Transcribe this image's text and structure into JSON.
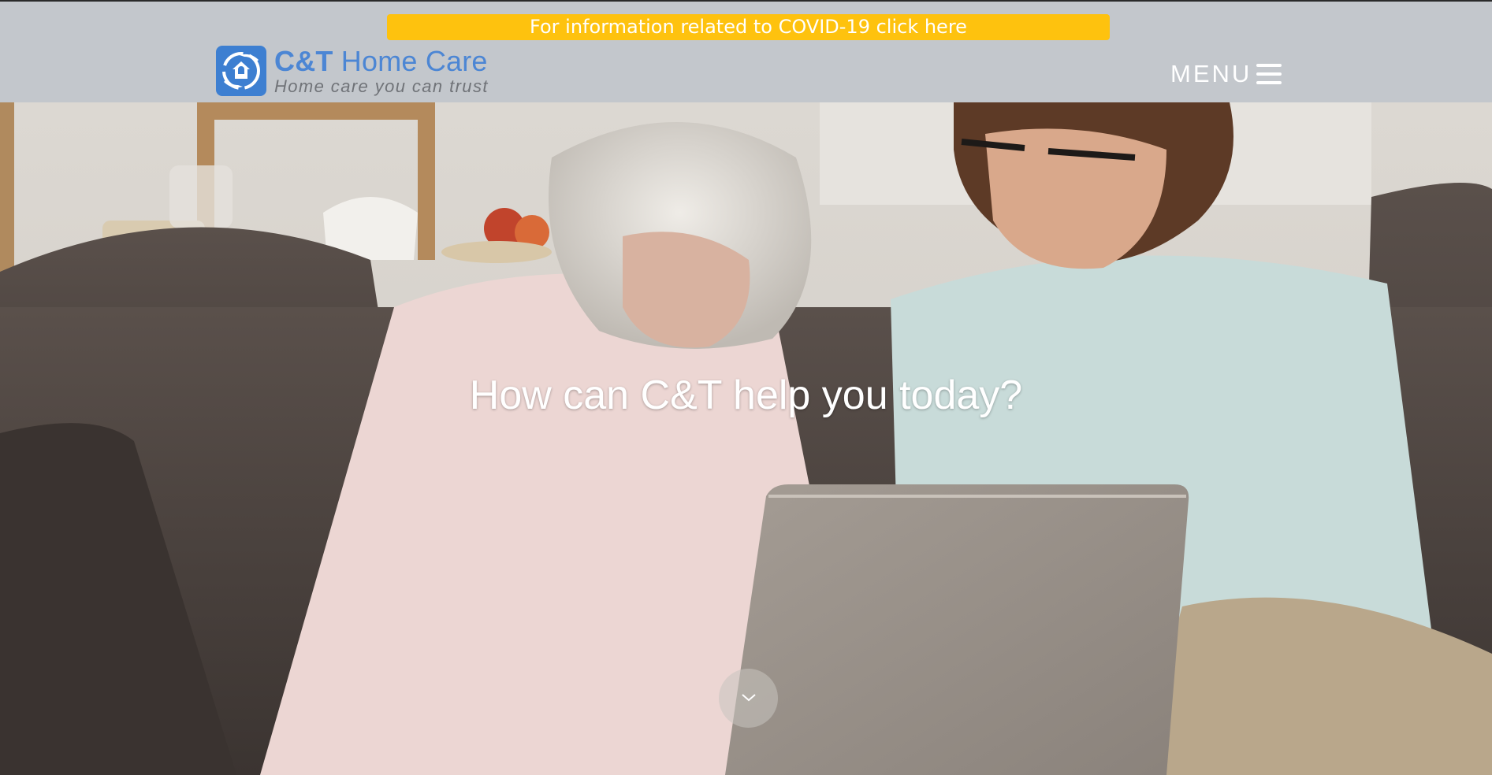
{
  "announcement": {
    "text": "For information related to COVID-19 click here",
    "color": "#fec20e"
  },
  "logo": {
    "brand": "C&T",
    "name": "Home Care",
    "tagline": "Home care you can trust",
    "color": "#4c86d4"
  },
  "nav": {
    "menu_label": "MENU",
    "menu_icon": "hamburger-icon"
  },
  "hero": {
    "headline": "How can C&T help you today?",
    "scroll_icon": "chevron-down-icon",
    "image": "elderly-woman-and-young-woman-on-sofa-with-laptop"
  }
}
